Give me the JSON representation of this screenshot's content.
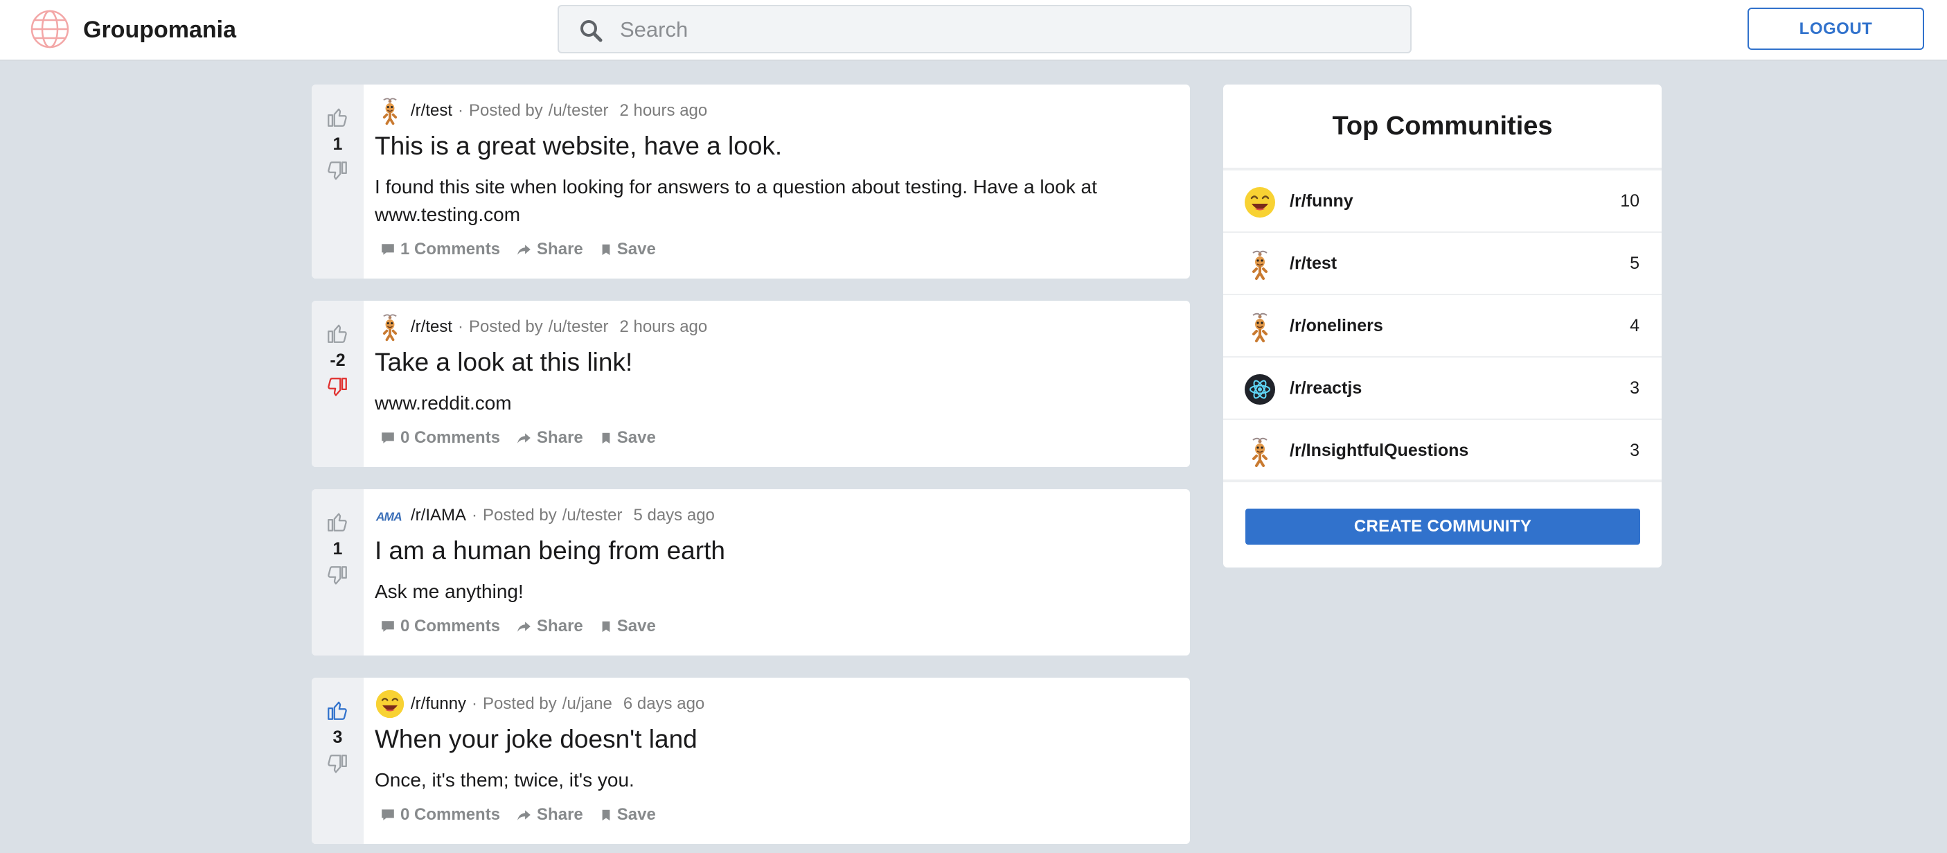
{
  "header": {
    "brand": "Groupomania",
    "search_placeholder": "Search",
    "logout_label": "LOGOUT"
  },
  "posts": [
    {
      "score": "1",
      "vote": "none",
      "community": "/r/test",
      "avatar": "mascot-icon",
      "posted_by": "Posted by",
      "user": "/u/tester",
      "time": "2 hours ago",
      "title": "This is a great website, have a look.",
      "content": "I found this site when looking for answers to a question about testing. Have a look at www.testing.com",
      "comments": "1 Comments",
      "share": "Share",
      "save": "Save"
    },
    {
      "score": "-2",
      "vote": "down",
      "community": "/r/test",
      "avatar": "mascot-icon",
      "posted_by": "Posted by",
      "user": "/u/tester",
      "time": "2 hours ago",
      "title": "Take a look at this link!",
      "content": "www.reddit.com",
      "comments": "0 Comments",
      "share": "Share",
      "save": "Save"
    },
    {
      "score": "1",
      "vote": "none",
      "community": "/r/IAMA",
      "avatar": "ama-logo",
      "posted_by": "Posted by",
      "user": "/u/tester",
      "time": "5 days ago",
      "title": "I am a human being from earth",
      "content": "Ask me anything!",
      "comments": "0 Comments",
      "share": "Share",
      "save": "Save"
    },
    {
      "score": "3",
      "vote": "up",
      "community": "/r/funny",
      "avatar": "laughing-emoji-icon",
      "posted_by": "Posted by",
      "user": "/u/jane",
      "time": "6 days ago",
      "title": "When your joke doesn't land",
      "content": "Once, it's them; twice, it's you.",
      "comments": "0 Comments",
      "share": "Share",
      "save": "Save"
    }
  ],
  "sidebar": {
    "title": "Top Communities",
    "communities": [
      {
        "name": "/r/funny",
        "count": "10",
        "icon": "laughing-emoji-icon"
      },
      {
        "name": "/r/test",
        "count": "5",
        "icon": "mascot-icon"
      },
      {
        "name": "/r/oneliners",
        "count": "4",
        "icon": "mascot-icon"
      },
      {
        "name": "/r/reactjs",
        "count": "3",
        "icon": "react-icon"
      },
      {
        "name": "/r/InsightfulQuestions",
        "count": "3",
        "icon": "mascot-icon"
      }
    ],
    "create_label": "CREATE COMMUNITY"
  },
  "colors": {
    "accent": "#3172cc",
    "background": "#dae0e6",
    "downvote": "#e0302e",
    "upvote": "#3172cc",
    "muted": "#878a8c"
  }
}
